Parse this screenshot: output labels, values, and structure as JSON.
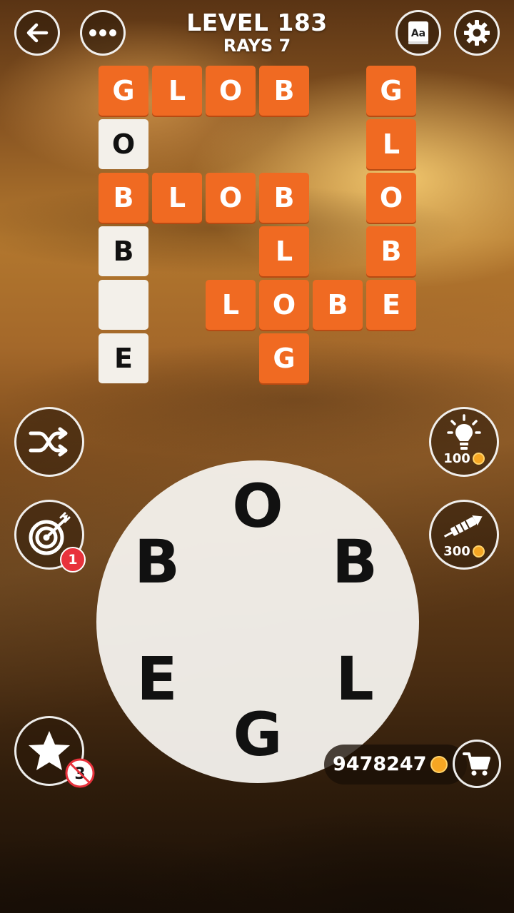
{
  "header": {
    "level": "LEVEL 183",
    "subtitle": "RAYS 7"
  },
  "grid": {
    "tiles": [
      {
        "letter": "G",
        "state": "filled",
        "col": 0,
        "row": 0
      },
      {
        "letter": "L",
        "state": "filled",
        "col": 1,
        "row": 0
      },
      {
        "letter": "O",
        "state": "filled",
        "col": 2,
        "row": 0
      },
      {
        "letter": "B",
        "state": "filled",
        "col": 3,
        "row": 0
      },
      {
        "letter": "G",
        "state": "filled",
        "col": 5,
        "row": 0
      },
      {
        "letter": "O",
        "state": "blank",
        "col": 0,
        "row": 1
      },
      {
        "letter": "L",
        "state": "filled",
        "col": 5,
        "row": 1
      },
      {
        "letter": "B",
        "state": "filled",
        "col": 0,
        "row": 2
      },
      {
        "letter": "L",
        "state": "filled",
        "col": 1,
        "row": 2
      },
      {
        "letter": "O",
        "state": "filled",
        "col": 2,
        "row": 2
      },
      {
        "letter": "B",
        "state": "filled",
        "col": 3,
        "row": 2
      },
      {
        "letter": "O",
        "state": "filled",
        "col": 5,
        "row": 2
      },
      {
        "letter": "B",
        "state": "blank",
        "col": 0,
        "row": 3
      },
      {
        "letter": "L",
        "state": "filled",
        "col": 3,
        "row": 3
      },
      {
        "letter": "B",
        "state": "filled",
        "col": 5,
        "row": 3
      },
      {
        "letter": "",
        "state": "blank",
        "col": 0,
        "row": 4
      },
      {
        "letter": "L",
        "state": "filled",
        "col": 2,
        "row": 4
      },
      {
        "letter": "O",
        "state": "filled",
        "col": 3,
        "row": 4
      },
      {
        "letter": "B",
        "state": "filled",
        "col": 4,
        "row": 4
      },
      {
        "letter": "E",
        "state": "filled",
        "col": 5,
        "row": 4
      },
      {
        "letter": "E",
        "state": "blank",
        "col": 0,
        "row": 5
      },
      {
        "letter": "G",
        "state": "filled",
        "col": 3,
        "row": 5
      }
    ]
  },
  "wheel": {
    "letters": [
      "O",
      "B",
      "L",
      "G",
      "E",
      "B"
    ]
  },
  "powerups": {
    "hint_cost": "100",
    "rocket_cost": "300",
    "target_badge": "1",
    "star_badge": "3"
  },
  "coins": "9478247",
  "icons": {
    "back": "arrow-left-icon",
    "menu": "more-dots-icon",
    "dictionary": "dictionary-icon",
    "settings": "gear-icon",
    "shuffle": "shuffle-icon",
    "target": "target-icon",
    "hint": "lightbulb-icon",
    "rocket": "rocket-icon",
    "star": "star-icon",
    "cart": "cart-icon"
  },
  "colors": {
    "tile_filled": "#f06a22",
    "tile_blank": "#f3f0ea",
    "badge_red": "#e8323c",
    "coin": "#f5a623"
  }
}
